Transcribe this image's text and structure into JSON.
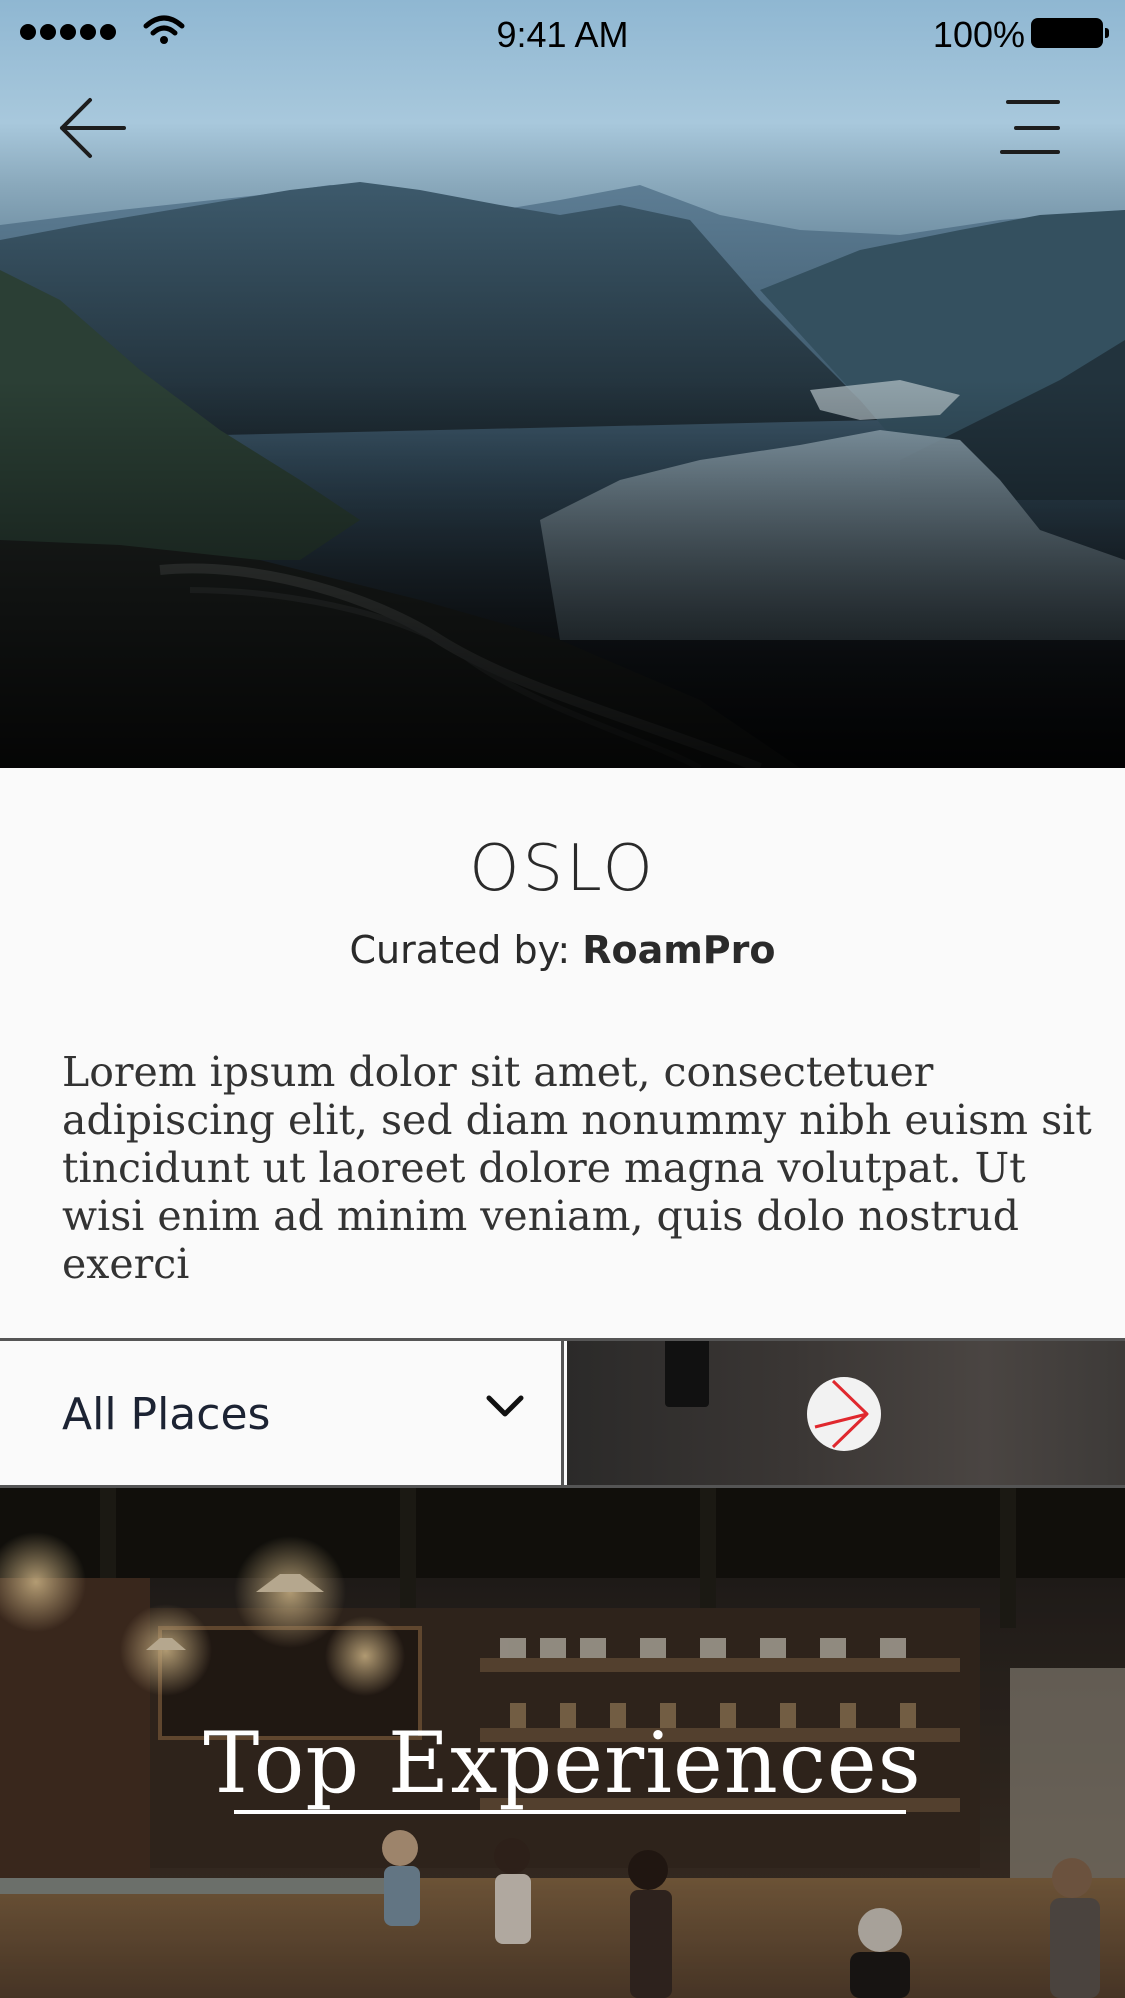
{
  "status_bar": {
    "time": "9:41 AM",
    "battery": "100%"
  },
  "nav": {
    "back_icon": "arrow-left-icon",
    "menu_icon": "hamburger-menu-icon"
  },
  "destination": {
    "city": "OSLO",
    "curated_prefix": "Curated by: ",
    "curator": "RoamPro",
    "description": "Lorem ipsum dolor sit amet, consectetuer adipiscing elit, sed diam nonummy nibh euism sit tincidunt ut laoreet dolore magna volutpat. Ut wisi enim ad minim veniam, quis dolo nostrud exerci"
  },
  "filter": {
    "selected": "All Places",
    "chevron_icon": "chevron-down-icon",
    "media_icon": "play-icon"
  },
  "section": {
    "title": "Top Experiences"
  },
  "colors": {
    "text_dark": "#2a2a2a",
    "play_accent": "#e0282e",
    "divider": "#555555"
  }
}
